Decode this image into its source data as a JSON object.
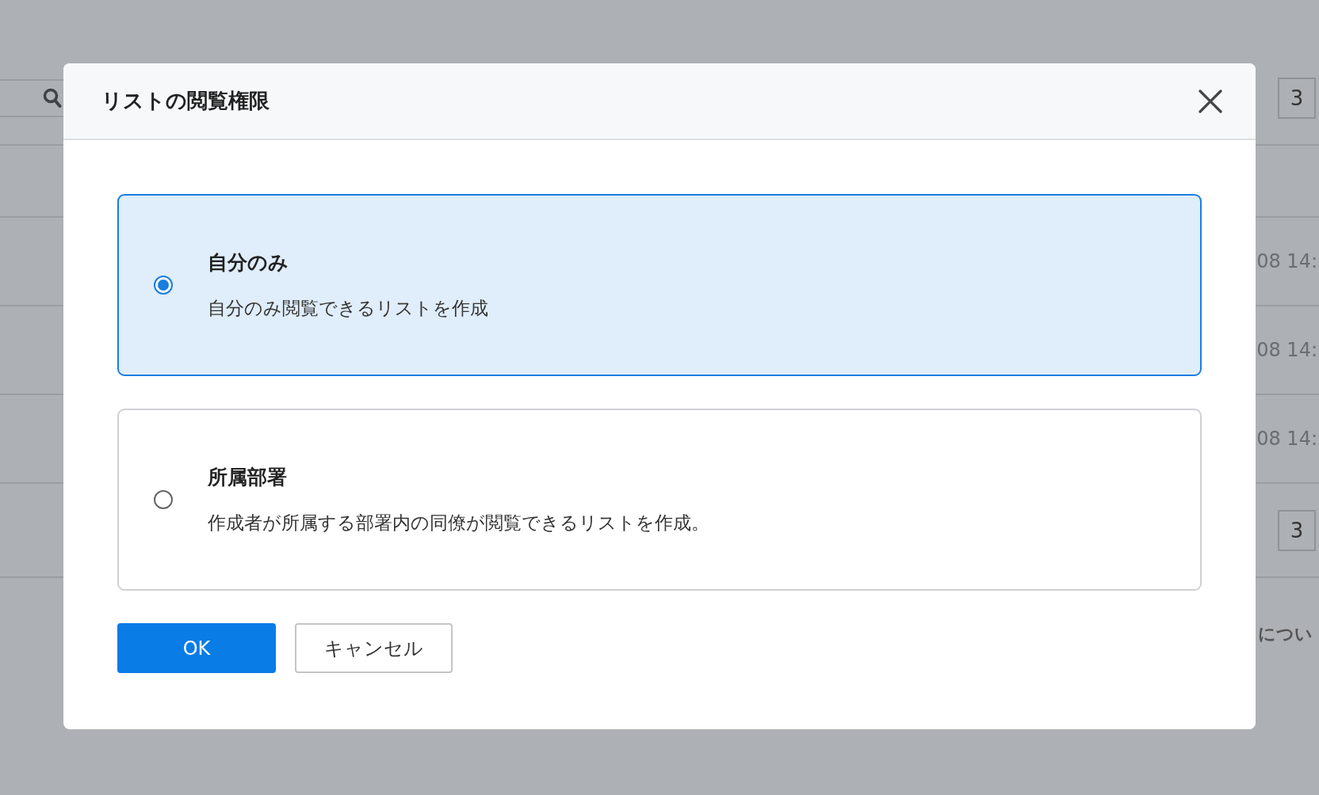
{
  "background": {
    "top_pagination": [
      "3"
    ],
    "rows": [
      {},
      {},
      {
        "time": "08 14:"
      },
      {
        "time": "08 14:"
      },
      {
        "time": "08 14:"
      }
    ],
    "bottom_pagination": [
      "3"
    ],
    "footer_text": "につい"
  },
  "dialog": {
    "title": "リストの閲覧権限",
    "options": [
      {
        "title": "自分のみ",
        "description": "自分のみ閲覧できるリストを作成",
        "selected": true
      },
      {
        "title": "所属部署",
        "description": "作成者が所属する部署内の同僚が閲覧できるリストを作成。",
        "selected": false
      }
    ],
    "buttons": [
      {
        "label": "OK",
        "kind": "primary"
      },
      {
        "label": "キャンセル",
        "kind": "secondary"
      }
    ]
  }
}
